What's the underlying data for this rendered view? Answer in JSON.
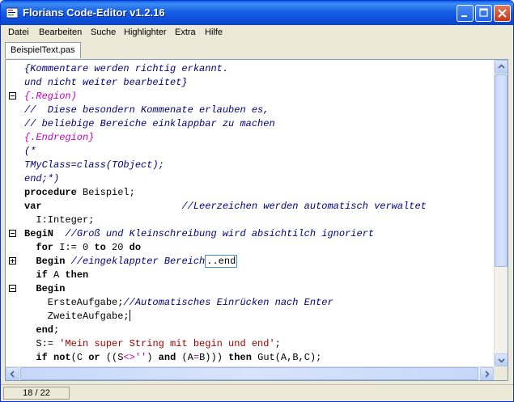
{
  "window": {
    "title": "Florians Code-Editor v1.2.16"
  },
  "menu": [
    "Datei",
    "Bearbeiten",
    "Suche",
    "Highlighter",
    "Extra",
    "Hilfe"
  ],
  "tabs": [
    {
      "label": "BeispielText.pas"
    }
  ],
  "editor": {
    "lines": [
      [
        {
          "t": "{Kommentare werden richtig erkannt.",
          "c": "cm"
        }
      ],
      [
        {
          "t": "und nicht weiter bearbeitet}",
          "c": "cm"
        }
      ],
      [
        {
          "t": "{.Region)",
          "c": "rg"
        }
      ],
      [
        {
          "t": "//  Diese besondern Kommenate erlauben es,",
          "c": "cm"
        }
      ],
      [
        {
          "t": "// beliebige Bereiche einklappbar zu machen",
          "c": "cm"
        }
      ],
      [
        {
          "t": "{.Endregion}",
          "c": "rg"
        }
      ],
      [
        {
          "t": "(*",
          "c": "cm"
        }
      ],
      [
        {
          "t": "TMyClass=class(TObject);",
          "c": "cm"
        }
      ],
      [
        {
          "t": "end;*)",
          "c": "cm"
        }
      ],
      [
        {
          "t": "procedure",
          "c": "kw"
        },
        {
          "t": " Beispiel;",
          "c": "tx"
        }
      ],
      [
        {
          "t": "var",
          "c": "kw"
        },
        {
          "t": "                        ",
          "c": "tx"
        },
        {
          "t": "//Leerzeichen werden automatisch verwaltet",
          "c": "cm"
        }
      ],
      [
        {
          "t": "  I:Integer;",
          "c": "tx"
        }
      ],
      [
        {
          "t": "BegiN",
          "c": "kw"
        },
        {
          "t": "  ",
          "c": "tx"
        },
        {
          "t": "//Groß und Kleinschreibung wird absichtilch ignoriert",
          "c": "cm"
        }
      ],
      [
        {
          "t": "  ",
          "c": "tx"
        },
        {
          "t": "for",
          "c": "kw"
        },
        {
          "t": " I:= 0 ",
          "c": "tx"
        },
        {
          "t": "to",
          "c": "kw"
        },
        {
          "t": " 20 ",
          "c": "tx"
        },
        {
          "t": "do",
          "c": "kw"
        }
      ],
      [
        {
          "t": "  ",
          "c": "tx"
        },
        {
          "t": "Begin",
          "c": "kw"
        },
        {
          "t": " ",
          "c": "tx"
        },
        {
          "t": "//eingeklappter Bereich",
          "c": "cm"
        },
        {
          "t": "..end",
          "c": "fb"
        }
      ],
      [
        {
          "t": "  ",
          "c": "tx"
        },
        {
          "t": "if",
          "c": "kw"
        },
        {
          "t": " A ",
          "c": "tx"
        },
        {
          "t": "then",
          "c": "kw"
        }
      ],
      [
        {
          "t": "  ",
          "c": "tx"
        },
        {
          "t": "Begin",
          "c": "kw"
        }
      ],
      [
        {
          "t": "    ErsteAufgabe;",
          "c": "tx"
        },
        {
          "t": "//Automatisches Einrücken nach Enter",
          "c": "cm"
        }
      ],
      [
        {
          "t": "    ZweiteAufgabe;",
          "c": "tx"
        },
        {
          "t": "",
          "c": "caret"
        }
      ],
      [
        {
          "t": "  ",
          "c": "tx"
        },
        {
          "t": "end",
          "c": "kw"
        },
        {
          "t": ";",
          "c": "tx"
        }
      ],
      [
        {
          "t": "  S:= ",
          "c": "tx"
        },
        {
          "t": "'Mein super String mit begin und end'",
          "c": "st"
        },
        {
          "t": ";",
          "c": "tx"
        }
      ],
      [
        {
          "t": "  ",
          "c": "tx"
        },
        {
          "t": "if",
          "c": "kw"
        },
        {
          "t": " ",
          "c": "tx"
        },
        {
          "t": "not",
          "c": "kw"
        },
        {
          "t": "(C ",
          "c": "tx"
        },
        {
          "t": "or",
          "c": "kw"
        },
        {
          "t": " ((S",
          "c": "tx"
        },
        {
          "t": "<>''",
          "c": "op"
        },
        {
          "t": ") ",
          "c": "tx"
        },
        {
          "t": "and",
          "c": "kw"
        },
        {
          "t": " (A",
          "c": "tx"
        },
        {
          "t": "=",
          "c": "op"
        },
        {
          "t": "B))) ",
          "c": "tx"
        },
        {
          "t": "then",
          "c": "kw"
        },
        {
          "t": " Gut(A,B,C);",
          "c": "tx"
        }
      ]
    ]
  },
  "status": {
    "position": "18 / 22"
  }
}
